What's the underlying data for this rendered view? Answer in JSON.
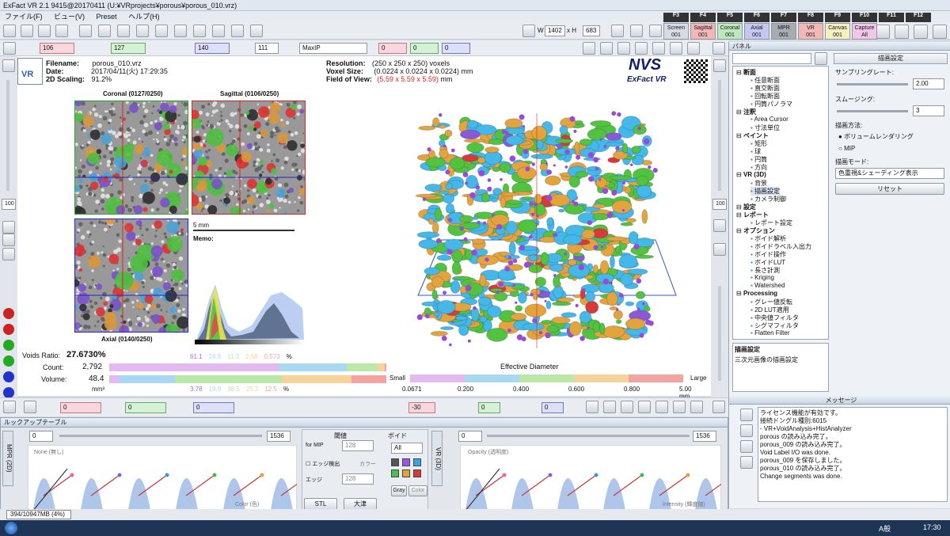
{
  "window": {
    "title": "ExFact VR 2.1 9415@20170411 (U:¥VRprojects¥porous¥porous_010.vrz)"
  },
  "menu": [
    "ファイル(F)",
    "ビュー(V)",
    "Preset",
    "ヘルプ(H)"
  ],
  "toolbar": {
    "w_label": "W",
    "w_value": "1402",
    "h_label": "x H",
    "h_value": "683",
    "fkeys": [
      "F3",
      "F4",
      "F5",
      "F6",
      "F7",
      "F8",
      "F9",
      "F10",
      "F11",
      "F12"
    ],
    "views": [
      {
        "label": "Screen",
        "num": "001",
        "color": "#d8dce2"
      },
      {
        "label": "Sagittal",
        "num": "001",
        "color": "#f3b7b7"
      },
      {
        "label": "Coronal",
        "num": "001",
        "color": "#bde8bd"
      },
      {
        "label": "Axial",
        "num": "001",
        "color": "#c4c8f0"
      },
      {
        "label": "MPR",
        "num": "001",
        "color": "#a7abb2"
      },
      {
        "label": "VR",
        "num": "001",
        "color": "#f3b7b7"
      },
      {
        "label": "Canvas",
        "num": "001",
        "color": "#f6f0c0"
      },
      {
        "label": "Capture",
        "num": "All",
        "color": "#f1c6e9"
      }
    ]
  },
  "toolbar2": {
    "val1": "106",
    "val2": "127",
    "val3": "140",
    "val4": "111",
    "mode": "MaxIP",
    "zero1": "0",
    "zero2": "0",
    "zero3": "0"
  },
  "info": {
    "filename_label": "Filename:",
    "filename": "porous_010.vrz",
    "date_label": "Date:",
    "date": "2017/04/11(火) 17:29:35",
    "scaling_label": "2D Scaling:",
    "scaling": "91.2%",
    "resolution_label": "Resolution:",
    "resolution": "(250 x 250 x 250) voxels",
    "voxel_label": "Voxel Size:",
    "voxel": "(0.0224 x 0.0224 x 0.0224) mm",
    "fov_label": "Field of View:",
    "fov": "(5.59 x 5.59 x 5.59)",
    "fov_unit": "mm"
  },
  "logo": {
    "main": "NVS",
    "sub": "ExFact VR",
    "vr_badge": "VR"
  },
  "slices": {
    "coronal": "Coronal (0127/0250)",
    "sagittal": "Sagittal (0106/0250)",
    "axial": "Axial (0140/0250)",
    "scale": "5 mm",
    "memo": "Memo:"
  },
  "stats": {
    "voids_label": "Voids Ratio:",
    "voids": "27.6730%",
    "count_label": "Count:",
    "count": "2,792",
    "volume_label": "Volume:",
    "volume": "48.4",
    "volume_unit": "mm³",
    "pct_top": [
      "61.1",
      "24.5",
      "11.3",
      "2.58",
      "0.573"
    ],
    "pct_unit": "%",
    "pct_bottom": [
      "3.78",
      "19.9",
      "38.5",
      "25.2",
      "12.5"
    ],
    "pct_unit2": "%",
    "eff_label": "Effective Diameter",
    "small": "Small",
    "large": "Large",
    "ticks": [
      "0.0671",
      "0.200",
      "0.400",
      "0.600",
      "0.800",
      "5.00 mm"
    ],
    "colors": [
      "#e4b8f0",
      "#a8d8f2",
      "#b9e8a8",
      "#f6d39a",
      "#f4a3a3"
    ]
  },
  "bottomtool": {
    "v1": "0",
    "v2": "0",
    "v3": "0",
    "v4": "-30",
    "v5": "0",
    "v6": "0",
    "v7": "0"
  },
  "lut": {
    "title": "ルックアップテーブル",
    "mpr_tab": "MPR (2D)",
    "vr_tab": "VR (3D)",
    "left_min": "0",
    "left_max": "1536",
    "right_min": "0",
    "right_max": "1536",
    "left_hint": "None (無し)",
    "left_foot": "Color (色)",
    "right_hint": "Opacity (透明度)",
    "right_foot": "Intensity (輝度値)",
    "threshold": "閾値",
    "for_mip": "for MIP",
    "thr_val": "128",
    "edge_label": "エッジ検出",
    "color_label": "カラー",
    "edge_val": "128",
    "edge_text": "エッジ",
    "void_label": "ボイド",
    "void_all": "All",
    "gray": "Gray",
    "color": "Color",
    "stl": "STL",
    "large": "大津"
  },
  "panel": {
    "title": "パネル",
    "tree": [
      {
        "t": "断面",
        "lvl": 0,
        "bold": true
      },
      {
        "t": "任意断面",
        "lvl": 1
      },
      {
        "t": "直交断面",
        "lvl": 1
      },
      {
        "t": "回転断面",
        "lvl": 1
      },
      {
        "t": "円筒パノラマ",
        "lvl": 1
      },
      {
        "t": "注釈",
        "lvl": 0,
        "bold": true
      },
      {
        "t": "Area Cursor",
        "lvl": 1
      },
      {
        "t": "寸法単位",
        "lvl": 1
      },
      {
        "t": "ペイント",
        "lvl": 0,
        "bold": true
      },
      {
        "t": "矩形",
        "lvl": 1
      },
      {
        "t": "球",
        "lvl": 1
      },
      {
        "t": "円筒",
        "lvl": 1
      },
      {
        "t": "方向",
        "lvl": 1
      },
      {
        "t": "VR (3D)",
        "lvl": 0,
        "bold": true
      },
      {
        "t": "背景",
        "lvl": 1
      },
      {
        "t": "描画設定",
        "lvl": 1,
        "sel": true
      },
      {
        "t": "カメラ制御",
        "lvl": 1
      },
      {
        "t": "設定",
        "lvl": 0,
        "bold": true
      },
      {
        "t": "レポート",
        "lvl": 0,
        "bold": true
      },
      {
        "t": "レポート設定",
        "lvl": 1
      },
      {
        "t": "オプション",
        "lvl": 0,
        "bold": true
      },
      {
        "t": "ボイド解析",
        "lvl": 1
      },
      {
        "t": "ボイドラベル入出力",
        "lvl": 1
      },
      {
        "t": "ボイド操作",
        "lvl": 1
      },
      {
        "t": "ボイドLUT",
        "lvl": 1
      },
      {
        "t": "長さ計測",
        "lvl": 1
      },
      {
        "t": "Kriging",
        "lvl": 1
      },
      {
        "t": "Watershed",
        "lvl": 1
      },
      {
        "t": "Processing",
        "lvl": 0,
        "bold": true
      },
      {
        "t": "グレー値反転",
        "lvl": 1
      },
      {
        "t": "2D LUT適用",
        "lvl": 1
      },
      {
        "t": "中央値フィルタ",
        "lvl": 1
      },
      {
        "t": "シグマフィルタ",
        "lvl": 1
      },
      {
        "t": "Flatten Filter",
        "lvl": 1
      }
    ],
    "desc_title": "描画設定",
    "desc": "三次元画像の描画設定",
    "settings_title": "描画設定",
    "sampling_label": "サンプリングレート:",
    "sampling": "2.00",
    "smoothing_label": "スムージング:",
    "smoothing": "3",
    "method_label": "描画方法:",
    "method1": "ボリュームレンダリング",
    "method2": "MIP",
    "mode_label": "描画モード:",
    "mode": "色重視&シェーディング表示",
    "reset": "リセット"
  },
  "messages": {
    "title": "メッセージ",
    "lines": [
      "ライセンス機能が有効です。",
      "接続ドングル種別:6015",
      "- VR+VoidAnalysis+HistAnalyzer",
      "porous の読み込み完了。",
      "porous_009 の読み込み完了。",
      "Void Label I/O was done.",
      "porous_009 を保存しました。",
      "porous_010 の読み込み完了。",
      "Change segments was done."
    ]
  },
  "memory": "394/10947MB (4%)",
  "taskbar": {
    "time": "17:30",
    "ime": "A般"
  }
}
